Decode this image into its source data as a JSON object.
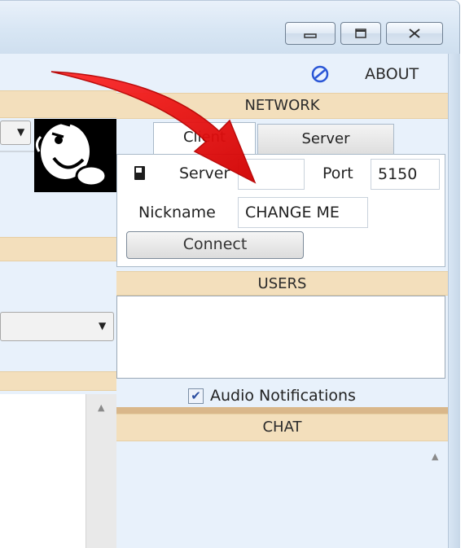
{
  "window": {
    "minimize_icon": "minimize-icon",
    "maximize_icon": "maximize-icon",
    "close_icon": "close-icon"
  },
  "toolbar": {
    "about_label": "ABOUT",
    "about_icon": "globe-icon"
  },
  "network": {
    "header": "NETWORK",
    "tabs": [
      {
        "label": "Client",
        "selected": true
      },
      {
        "label": "Server",
        "selected": false
      }
    ],
    "server_label": "Server",
    "server_value": "",
    "port_label": "Port",
    "port_value": "5150",
    "nickname_label": "Nickname",
    "nickname_value": "CHANGE ME",
    "connect_label": "Connect"
  },
  "users": {
    "header": "USERS",
    "items": []
  },
  "audio_notifications": {
    "label": "Audio Notifications",
    "checked": true
  },
  "chat": {
    "header": "CHAT"
  },
  "colors": {
    "header_bg": "#f3dfbc",
    "client_bg": "#e8f1fb",
    "annotation_arrow": "#e01010"
  }
}
